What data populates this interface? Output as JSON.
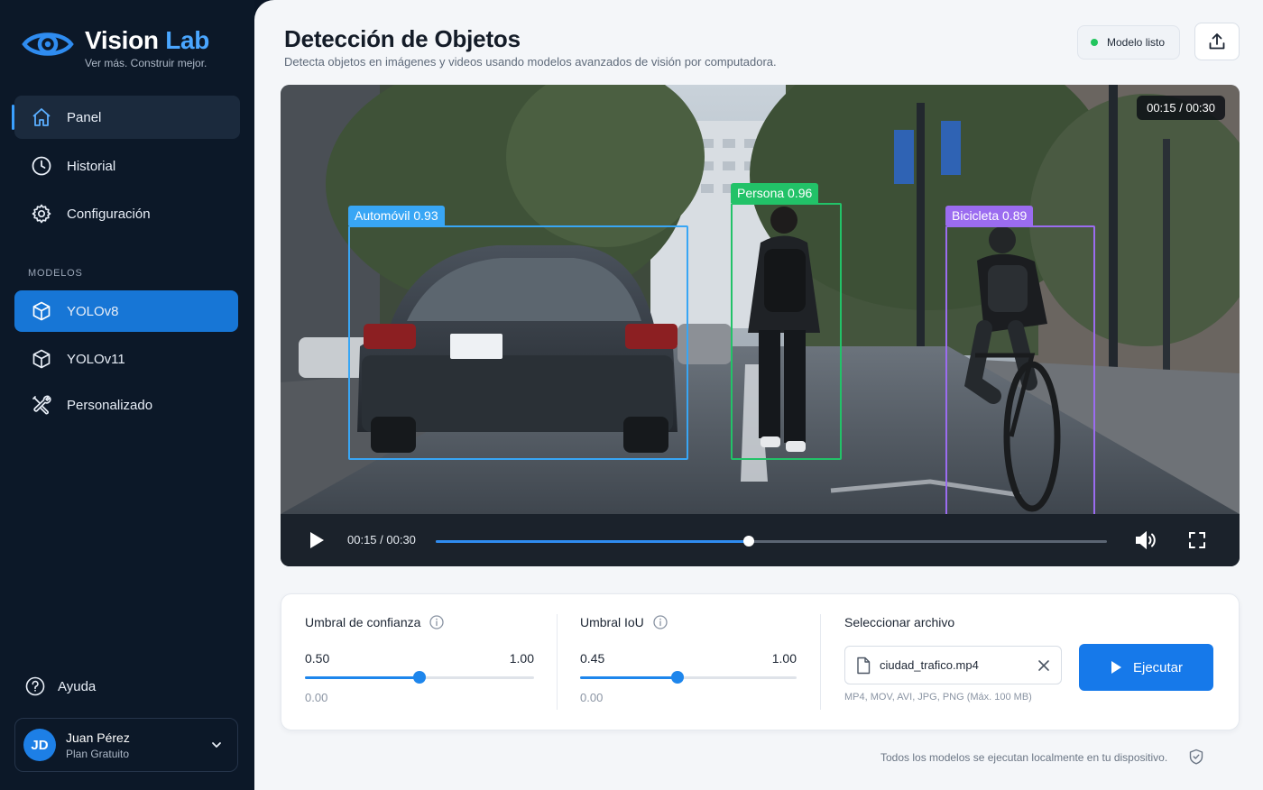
{
  "brand": {
    "name_part1": "Vision",
    "name_part2": "Lab",
    "tagline": "Ver más. Construir mejor."
  },
  "sidebar": {
    "nav": [
      {
        "label": "Panel",
        "icon": "home-icon",
        "active": true
      },
      {
        "label": "Historial",
        "icon": "clock-icon"
      },
      {
        "label": "Configuración",
        "icon": "gear-icon"
      }
    ],
    "models_label": "MODELOS",
    "models": [
      {
        "label": "YOLOv8",
        "icon": "cube-icon",
        "active": true
      },
      {
        "label": "YOLOv11",
        "icon": "cube-icon"
      },
      {
        "label": "Personalizado",
        "icon": "tools-icon"
      }
    ],
    "help_label": "Ayuda",
    "user": {
      "initials": "JD",
      "name": "Juan Pérez",
      "plan": "Plan Gratuito"
    }
  },
  "header": {
    "title": "Detección de Objetos",
    "subtitle": "Detecta objetos en imágenes y videos usando modelos avanzados de visión por computadora.",
    "status": "Modelo listo"
  },
  "video": {
    "time_overlay": "00:15 / 00:30",
    "current_time": "00:15 / 00:30",
    "progress": 0.467,
    "detections": [
      {
        "label": "Automóvil 0.93",
        "color": "#38a6f5"
      },
      {
        "label": "Persona 0.96",
        "color": "#22c268"
      },
      {
        "label": "Bicicleta 0.89",
        "color": "#9b6cf0"
      }
    ]
  },
  "settings": {
    "confidence": {
      "title": "Umbral de confianza",
      "value": "0.50",
      "value_num": 0.5,
      "max": "1.00",
      "min": "0.00"
    },
    "iou": {
      "title": "Umbral IoU",
      "value": "0.45",
      "value_num": 0.45,
      "max": "1.00",
      "min": "0.00"
    },
    "file": {
      "title": "Seleccionar archivo",
      "filename": "ciudad_trafico.mp4",
      "hint": "MP4, MOV, AVI, JPG, PNG (Máx. 100 MB)"
    },
    "run_label": "Ejecutar"
  },
  "footer": {
    "note": "Todos los modelos se ejecutan localmente en tu dispositivo."
  },
  "colors": {
    "accent": "#1679ea",
    "sidebar_bg": "#0c1828",
    "status_ok": "#22c55e"
  }
}
